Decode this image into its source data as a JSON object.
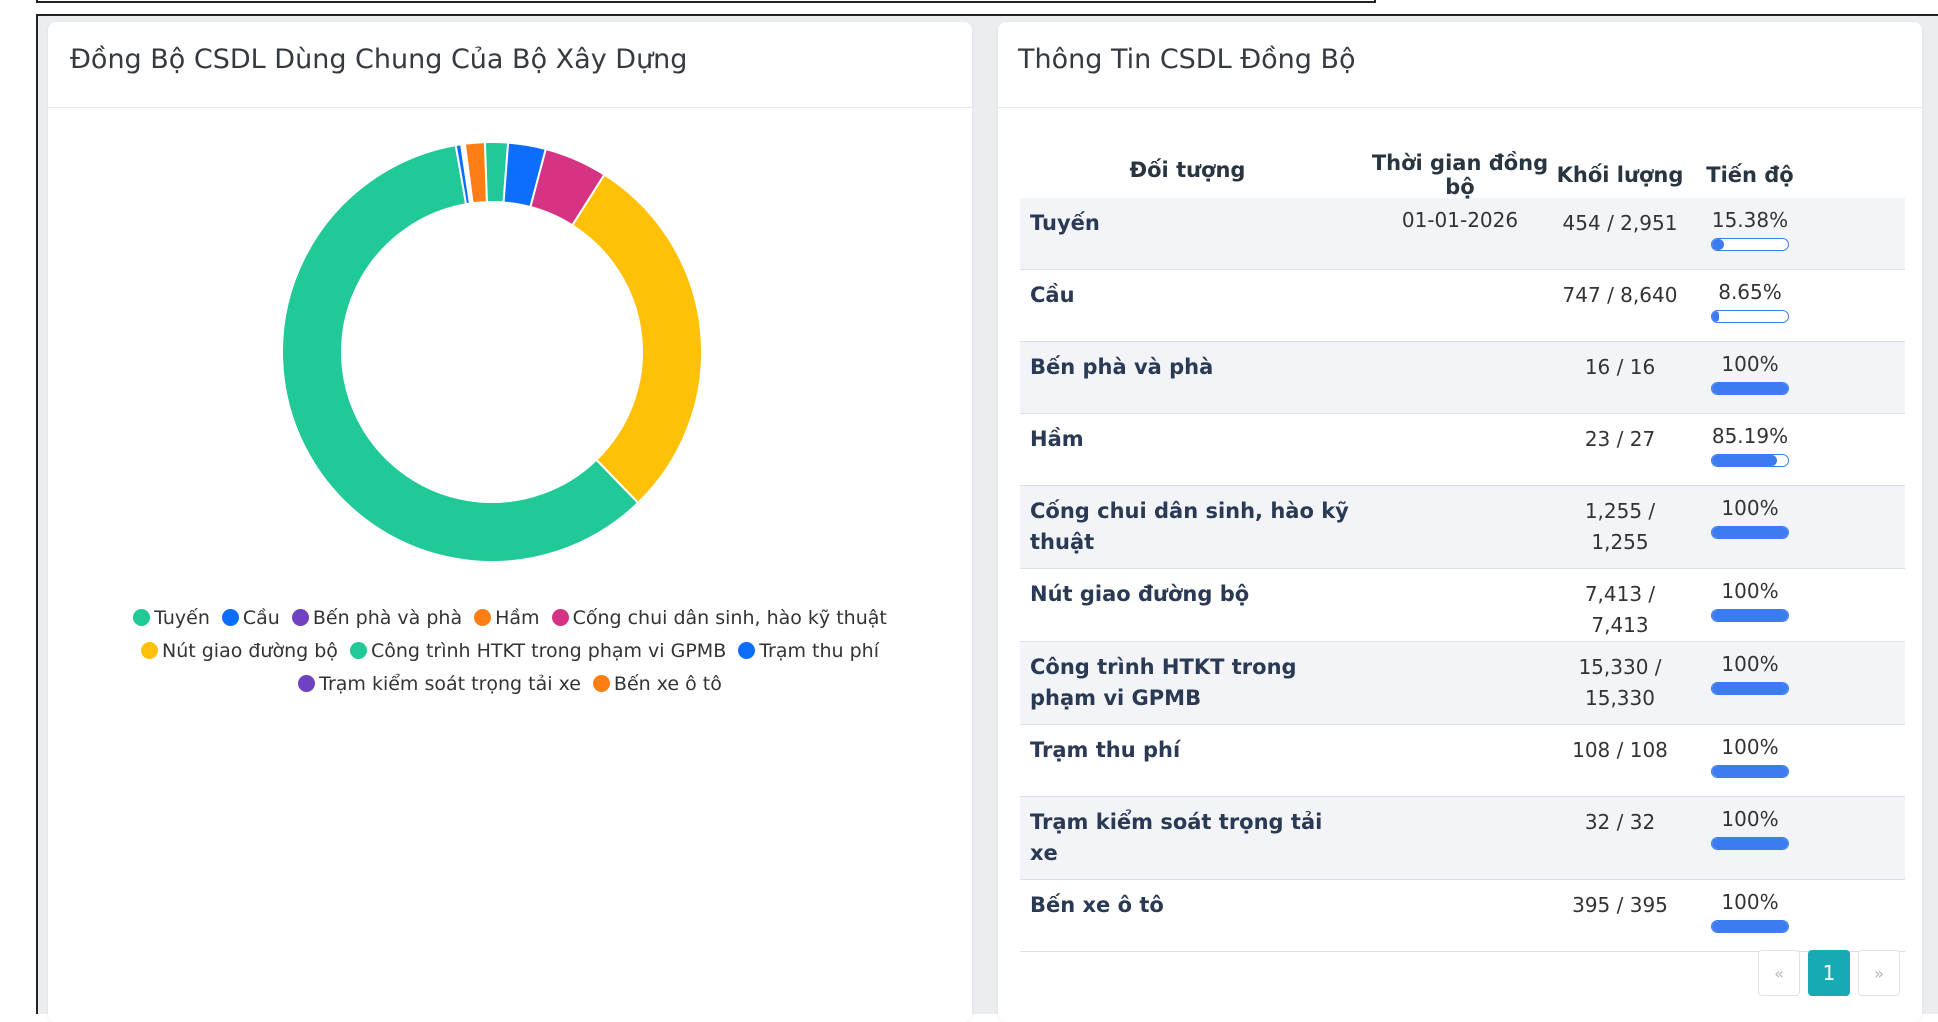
{
  "left_panel": {
    "title": "Đồng Bộ CSDL Dùng Chung Của Bộ Xây Dựng"
  },
  "chart_data": {
    "type": "pie",
    "donut": true,
    "legend_position": "bottom",
    "categories": [
      "Tuyến",
      "Cầu",
      "Bến phà và phà",
      "Hầm",
      "Cống chui dân sinh, hào kỹ thuật",
      "Nút giao đường bộ",
      "Công trình HTKT trong phạm vi GPMB",
      "Trạm thu phí",
      "Trạm kiểm soát trọng tải xe",
      "Bến xe ô tô"
    ],
    "values": [
      15330,
      747,
      16,
      395,
      1255,
      7413,
      454,
      108,
      32,
      23
    ],
    "segment_order": [
      "Bến xe ô tô",
      "Tuyến",
      "Cầu",
      "Cống chui dân sinh, hào kỹ thuật",
      "Nút giao đường bộ",
      "Công trình HTKT trong phạm vi GPMB",
      "Trạm thu phí",
      "Trạm kiểm soát trọng tải xe",
      "Bến phà và phà",
      "Hầm"
    ],
    "segment_values": [
      395,
      454,
      747,
      1255,
      7413,
      15330,
      108,
      32,
      16,
      23
    ],
    "segment_colors": [
      "#fd7e14",
      "#20c997",
      "#0d6efd",
      "#d63384",
      "#ffc107",
      "#20c997",
      "#0d6efd",
      "#6f42c1",
      "#6f42c1",
      "#fd7e14"
    ],
    "legend": [
      {
        "label": "Tuyến",
        "color": "#20c997"
      },
      {
        "label": "Cầu",
        "color": "#0d6efd"
      },
      {
        "label": "Bến phà và phà",
        "color": "#6f42c1"
      },
      {
        "label": "Hầm",
        "color": "#fd7e14"
      },
      {
        "label": "Cống chui dân sinh, hào kỹ thuật",
        "color": "#d63384"
      },
      {
        "label": "Nút giao đường bộ",
        "color": "#ffc107"
      },
      {
        "label": "Công trình HTKT trong phạm vi GPMB",
        "color": "#20c997"
      },
      {
        "label": "Trạm thu phí",
        "color": "#0d6efd"
      },
      {
        "label": "Trạm kiểm soát trọng tải xe",
        "color": "#6f42c1"
      },
      {
        "label": "Bến xe ô tô",
        "color": "#fd7e14"
      }
    ]
  },
  "right_panel": {
    "title": "Thông Tin CSDL Đồng Bộ",
    "columns": [
      "Đối tượng",
      "Thời gian đồng bộ",
      "Khối lượng",
      "Tiến độ"
    ],
    "rows": [
      {
        "name": "Tuyến",
        "time": "01-01-2026",
        "volume": "454 / 2,951",
        "progress_text": "15.38%",
        "progress": 15.38
      },
      {
        "name": "Cầu",
        "time": "",
        "volume": "747 / 8,640",
        "progress_text": "8.65%",
        "progress": 8.65
      },
      {
        "name": "Bến phà và phà",
        "time": "",
        "volume": "16 / 16",
        "progress_text": "100%",
        "progress": 100
      },
      {
        "name": "Hầm",
        "time": "",
        "volume": "23 / 27",
        "progress_text": "85.19%",
        "progress": 85.19
      },
      {
        "name": "Cống chui dân sinh, hào kỹ thuật",
        "time": "",
        "volume": "1,255 / 1,255",
        "progress_text": "100%",
        "progress": 100
      },
      {
        "name": "Nút giao đường bộ",
        "time": "",
        "volume": "7,413 / 7,413",
        "progress_text": "100%",
        "progress": 100
      },
      {
        "name": "Công trình HTKT trong phạm vi GPMB",
        "time": "",
        "volume": "15,330 / 15,330",
        "progress_text": "100%",
        "progress": 100
      },
      {
        "name": "Trạm thu phí",
        "time": "",
        "volume": "108 / 108",
        "progress_text": "100%",
        "progress": 100
      },
      {
        "name": "Trạm kiểm soát trọng tải xe",
        "time": "",
        "volume": "32 / 32",
        "progress_text": "100%",
        "progress": 100
      },
      {
        "name": "Bến xe ô tô",
        "time": "",
        "volume": "395 / 395",
        "progress_text": "100%",
        "progress": 100
      }
    ],
    "pagination": {
      "prev": "«",
      "current": "1",
      "next": "»"
    },
    "accent_color": "#3d7cf0",
    "pager_active_color": "#17a9b4"
  }
}
